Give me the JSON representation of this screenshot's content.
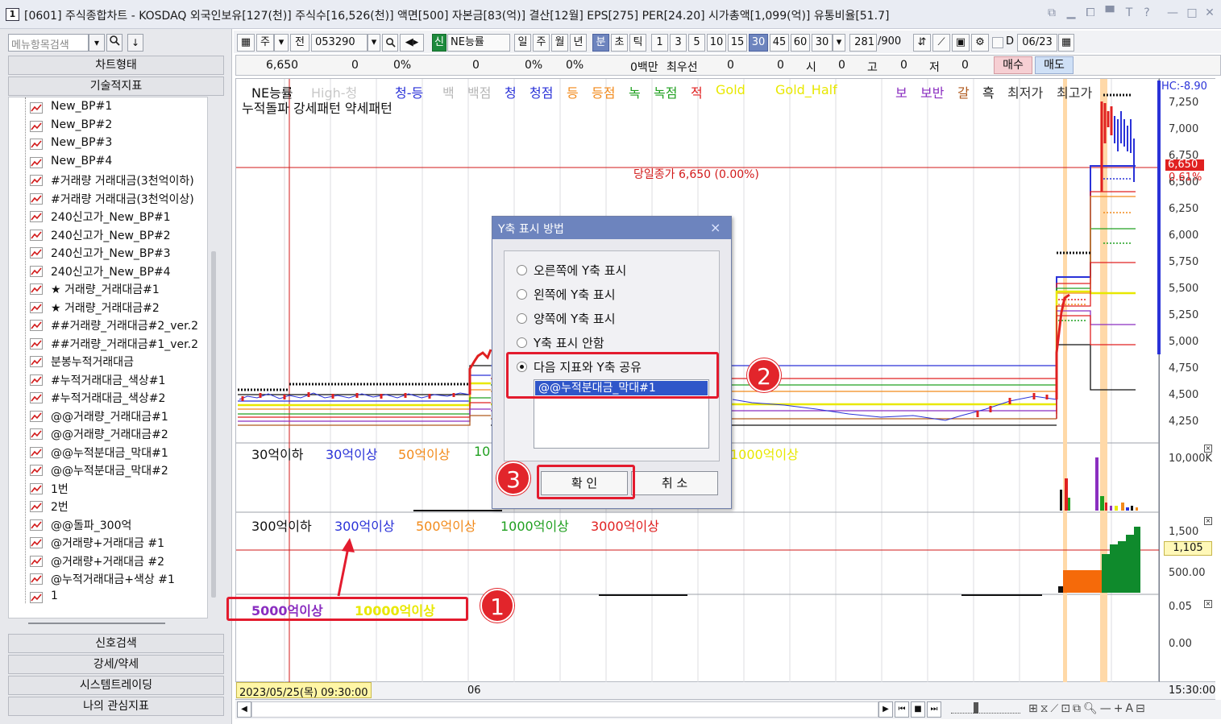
{
  "window": {
    "icon": "1",
    "title": "[0601] 주식종합차트 - KOSDAQ 외국인보유[127(천)] 주식수[16,526(천)] 액면[500] 자본금[83(억)] 결산[12월] EPS[275] PER[24.20] 시가총액[1,099(억)] 유통비율[51.7]",
    "controls": [
      "⧉",
      "▁",
      "⧠",
      "▀",
      "T",
      "?",
      "—",
      "□",
      "✕"
    ]
  },
  "left": {
    "menu_search_placeholder": "메뉴항목검색",
    "chart_type_btn": "차트형태",
    "tech_indicator_btn": "기술적지표",
    "indicators": [
      "New_BP#1",
      "New_BP#2",
      "New_BP#3",
      "New_BP#4",
      "#거래량 거래대금(3천억이하)",
      "#거래량 거래대금(3천억이상)",
      "240신고가_New_BP#1",
      "240신고가_New_BP#2",
      "240신고가_New_BP#3",
      "240신고가_New_BP#4",
      "★ 거래량_거래대금#1",
      "★ 거래량_거래대금#2",
      "##거래량_거래대금#2_ver.2",
      "##거래량_거래대금#1_ver.2",
      "분봉누적거래대금",
      "#누적거래대금_색상#1",
      "#누적거래대금_색상#2",
      "@@거래량_거래대금#1",
      "@@거래량_거래대금#2",
      "@@누적분대금_막대#1",
      "@@누적분대금_막대#2",
      "1번",
      "2번",
      "@@돌파_300억",
      "@거래량+거래대금 #1",
      "@거래량+거래대금 #2",
      "@누적거래대금+색상 #1",
      "1"
    ],
    "bottom_buttons": [
      "신호검색",
      "강세/약세",
      "시스템트레이딩",
      "나의 관심지표"
    ]
  },
  "toolbar": {
    "period_week": "주",
    "prev_label": "전",
    "code": "053290",
    "new_badge": "신",
    "stock_name": "NE능률",
    "periods": [
      "일",
      "주",
      "월",
      "년",
      "분",
      "초",
      "틱"
    ],
    "active_period": "분",
    "intervals": [
      "1",
      "3",
      "5",
      "10",
      "15",
      "30",
      "45",
      "60"
    ],
    "active_interval": "30",
    "interval_select": "30",
    "count": "281",
    "count_total": "/900",
    "date_prefix": "D",
    "date": "06/23"
  },
  "quote": {
    "price": "6,650",
    "change": "0",
    "change_pct": "0%",
    "volume": "0",
    "vol_pct": "0%",
    "turnover_pct": "0%",
    "amount_label": "0백만",
    "best_ask_label": "최우선",
    "best_ask": "0",
    "v2": "0",
    "open_label": "시",
    "open": "0",
    "high_label": "고",
    "high": "0",
    "low_label": "저",
    "low": "0",
    "buy_btn": "매수",
    "sell_btn": "매도"
  },
  "price_legend": {
    "items": [
      {
        "text": "NE능률",
        "color": "#111111"
      },
      {
        "text": "High-청",
        "color": "#c8c8c8"
      },
      {
        "text": "청-등",
        "color": "#2a32d8"
      },
      {
        "text": "백",
        "color": "#b7b7b7"
      },
      {
        "text": "백점",
        "color": "#b7b7b7"
      },
      {
        "text": "청",
        "color": "#2a32d8"
      },
      {
        "text": "청점",
        "color": "#2a32d8"
      },
      {
        "text": "등",
        "color": "#f28a1a"
      },
      {
        "text": "등점",
        "color": "#f28a1a"
      },
      {
        "text": "녹",
        "color": "#20a020"
      },
      {
        "text": "녹점",
        "color": "#20a020"
      },
      {
        "text": "적",
        "color": "#e02020"
      },
      {
        "text": "Gold",
        "color": "#e8e800"
      },
      {
        "text": "Gold_Half",
        "color": "#e8e800"
      },
      {
        "text": "보",
        "color": "#8a2ec0"
      },
      {
        "text": "보반",
        "color": "#8a2ec0"
      },
      {
        "text": "갈",
        "color": "#b05a1e"
      },
      {
        "text": "흑",
        "color": "#111111"
      },
      {
        "text": "최저가",
        "color": "#333333"
      },
      {
        "text": "최고가",
        "color": "#333333"
      }
    ],
    "line2": "누적돌파 강세패턴  약세패턴",
    "close_annotation": "당일종가 6,650 (0.00%)"
  },
  "pane2_legend": [
    "30억이하",
    "30억이상",
    "50억이상",
    "10",
    "1000억이상"
  ],
  "pane3_legend": [
    "300억이하",
    "300억이상",
    "500억이상",
    "1000억이상",
    "3000억이상"
  ],
  "pane4_legend": [
    "5000억이상",
    "10000억이상"
  ],
  "yaxis": {
    "hc_label": "HC:-8.90",
    "price_ticks": [
      "7,250",
      "7,000",
      "6,750",
      "6,500",
      "6,250",
      "6,000",
      "5,750",
      "5,500",
      "5,250",
      "5,000",
      "4,750",
      "4,500",
      "4,250"
    ],
    "price_current": "6,650",
    "price_pct": "0.61%",
    "pane2_ticks": [
      "10,000K"
    ],
    "pane3_ticks": [
      "1,500",
      "500.00"
    ],
    "pane3_current": "1,105",
    "pane4_ticks": [
      "0.05",
      "0.00"
    ]
  },
  "xaxis": {
    "cursor_date": "2023/05/25(목) 09:30:00",
    "tick_06": "06",
    "right_time": "15:30:00"
  },
  "dialog": {
    "title": "Y축 표시 방법",
    "close": "×",
    "options": [
      "오른쪽에 Y축 표시",
      "왼쪽에 Y축 표시",
      "양쪽에 Y축 표시",
      "Y축 표시 안함",
      "다음 지표와 Y축 공유"
    ],
    "selected_option": 4,
    "shared_indicator": "@@누적분대금_막대#1",
    "ok": "확  인",
    "cancel": "취  소"
  },
  "annotations": {
    "badge1": "1",
    "badge2": "2",
    "badge3": "3",
    "highlight_color": "#e31b2e"
  }
}
